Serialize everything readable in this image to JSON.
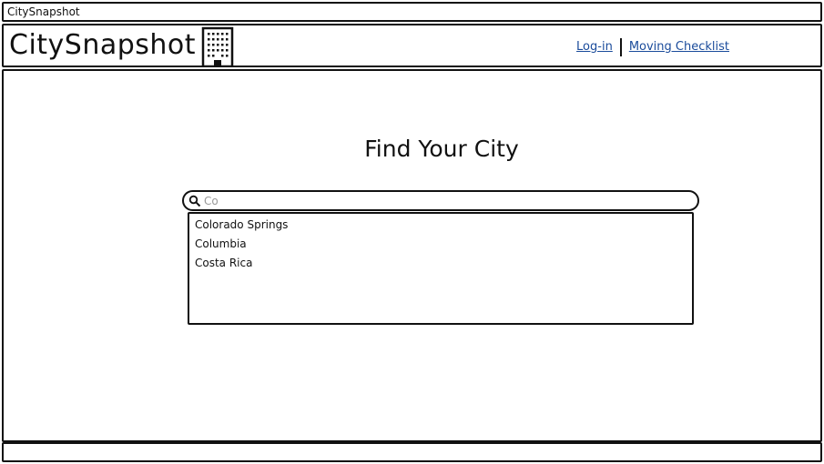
{
  "window": {
    "title": "CitySnapshot"
  },
  "header": {
    "logo_text": "CitySnapshot",
    "logo_icon": "building-icon",
    "nav": {
      "login_label": "Log-in",
      "checklist_label": "Moving Checklist"
    }
  },
  "main": {
    "heading": "Find Your City",
    "search": {
      "value": "Co",
      "icon": "search-icon"
    },
    "suggestions": [
      "Colorado Springs",
      "Columbia",
      "Costa Rica"
    ]
  },
  "colors": {
    "link": "#1a4b9b",
    "border": "#111111",
    "background": "#ffffff"
  }
}
